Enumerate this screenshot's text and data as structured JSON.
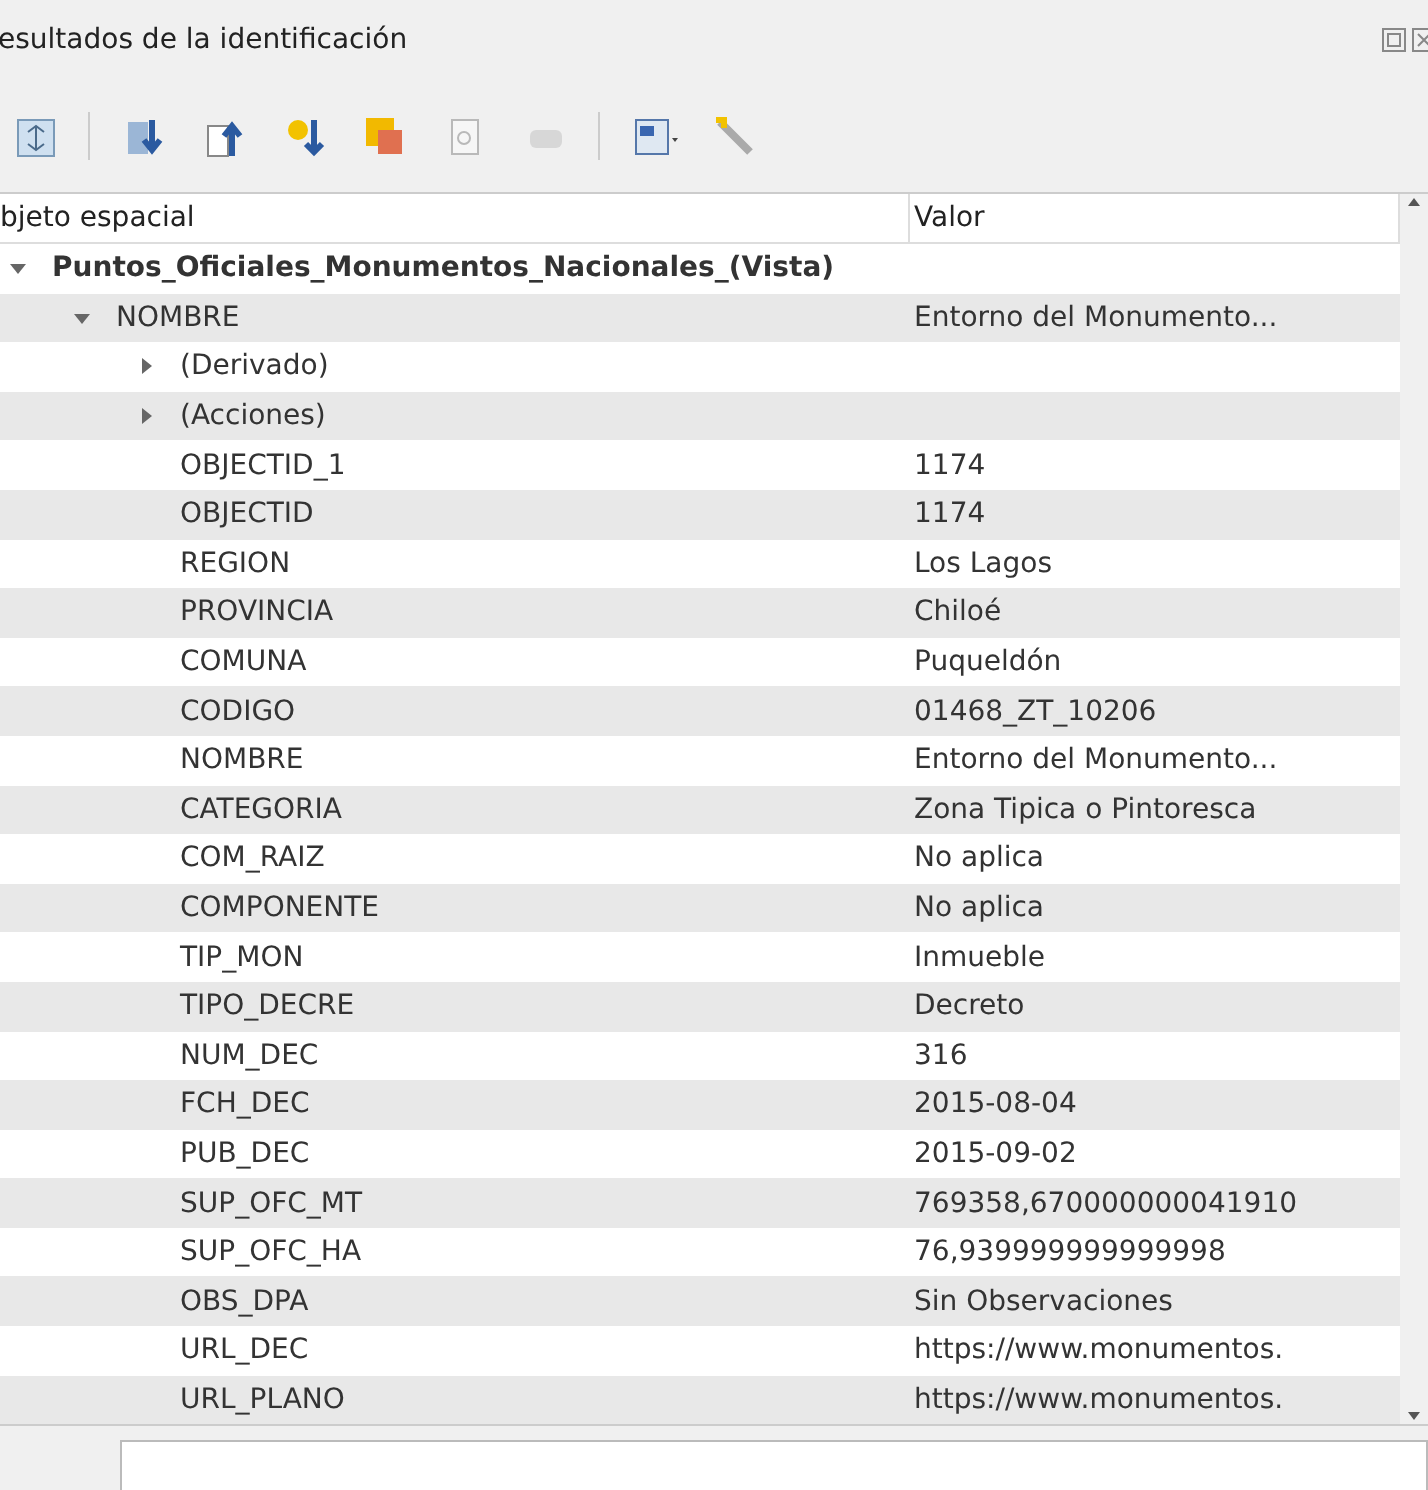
{
  "panel": {
    "title": "esultados de la identificación"
  },
  "table": {
    "columns": [
      "bjeto espacial",
      "Valor"
    ],
    "tree": [
      {
        "label": "Puntos_Oficiales_Monumentos_Nacionales_(Vista)",
        "expanded": true,
        "children": [
          {
            "label": "NOMBRE",
            "value": "Entorno del Monumento...",
            "expanded": true,
            "children": [
              {
                "label": "(Derivado)",
                "expanded": false
              },
              {
                "label": "(Acciones)",
                "expanded": false
              },
              {
                "label": "OBJECTID_1",
                "value": "1174"
              },
              {
                "label": "OBJECTID",
                "value": "1174"
              },
              {
                "label": "REGION",
                "value": "Los Lagos"
              },
              {
                "label": "PROVINCIA",
                "value": "Chiloé"
              },
              {
                "label": "COMUNA",
                "value": "Puqueldón"
              },
              {
                "label": "CODIGO",
                "value": "01468_ZT_10206"
              },
              {
                "label": "NOMBRE",
                "value": "Entorno del Monumento..."
              },
              {
                "label": "CATEGORIA",
                "value": "Zona Tipica o Pintoresca"
              },
              {
                "label": "COM_RAIZ",
                "value": "No aplica"
              },
              {
                "label": "COMPONENTE",
                "value": "No aplica"
              },
              {
                "label": "TIP_MON",
                "value": "Inmueble"
              },
              {
                "label": "TIPO_DECRE",
                "value": "Decreto"
              },
              {
                "label": "NUM_DEC",
                "value": "316"
              },
              {
                "label": "FCH_DEC",
                "value": "2015-08-04"
              },
              {
                "label": "PUB_DEC",
                "value": "2015-09-02"
              },
              {
                "label": "SUP_OFC_MT",
                "value": "769358,670000000041910"
              },
              {
                "label": "SUP_OFC_HA",
                "value": "76,939999999999998"
              },
              {
                "label": "OBS_DPA",
                "value": "Sin Observaciones"
              },
              {
                "label": "URL_DEC",
                "value": "https://www.monumentos."
              },
              {
                "label": "URL_PLANO",
                "value": "https://www.monumentos."
              }
            ]
          }
        ]
      }
    ]
  }
}
